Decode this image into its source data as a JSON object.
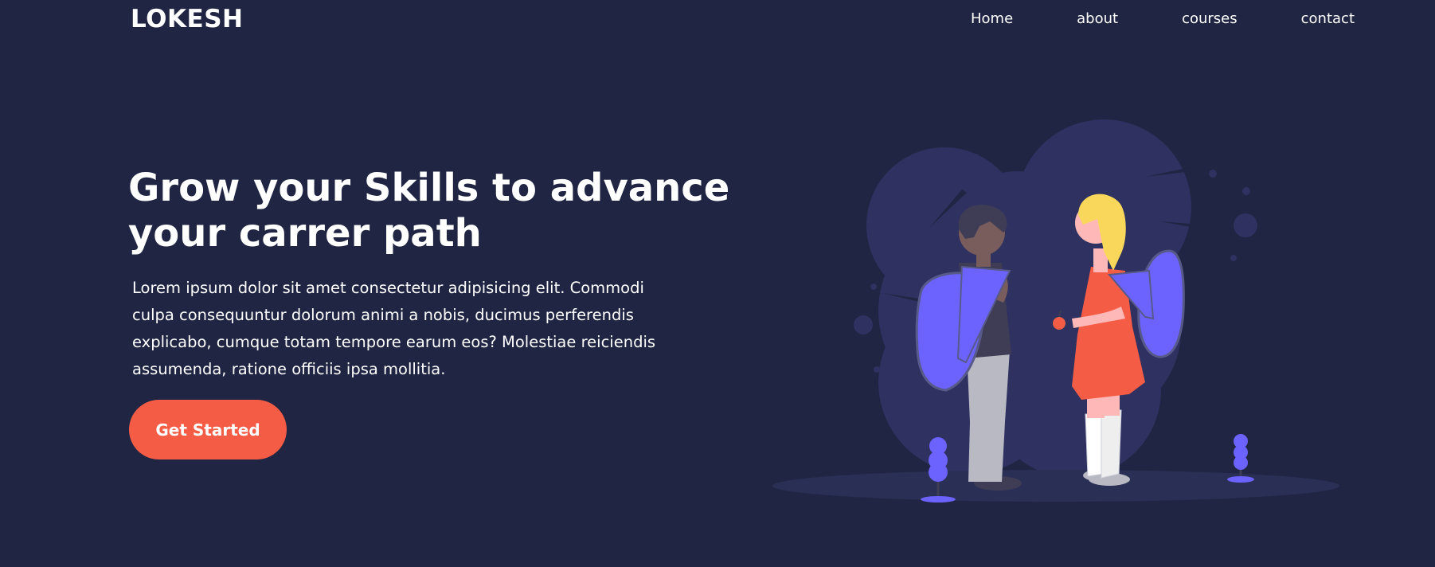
{
  "brand": {
    "logo": "LOKESH"
  },
  "nav": {
    "items": [
      {
        "label": "Home"
      },
      {
        "label": "about"
      },
      {
        "label": "courses"
      },
      {
        "label": "contact"
      }
    ]
  },
  "hero": {
    "title_line1": "Grow your Skills to advance",
    "title_line2": "your carrer path",
    "text": "Lorem ipsum dolor sit amet consectetur adipisicing elit. Commodi culpa consequuntur dolorum animi a nobis, ducimus perferendis explicabo, cumque totam tempore earum eos? Molestiae reiciendis assumenda, ratione officiis ipsa mollitia.",
    "cta_label": "Get Started"
  },
  "colors": {
    "background": "#1f2542",
    "accent": "#f55c45",
    "illustration_primary": "#6c63ff",
    "illustration_blob": "#2f3161"
  },
  "illustration": {
    "icon": "students-with-backpacks-illustration"
  }
}
